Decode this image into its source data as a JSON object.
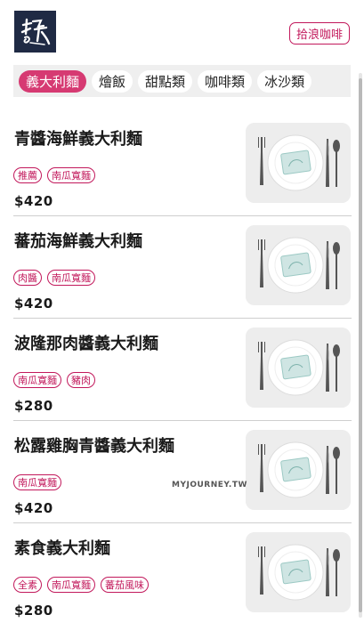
{
  "header": {
    "brand_button": "拾浪咖啡"
  },
  "tabs": [
    {
      "label": "義大利麵",
      "active": true
    },
    {
      "label": "燴飯",
      "active": false
    },
    {
      "label": "甜點類",
      "active": false
    },
    {
      "label": "咖啡類",
      "active": false
    },
    {
      "label": "冰沙類",
      "active": false
    }
  ],
  "menu": {
    "items": [
      {
        "name": "青醬海鮮義大利麵",
        "tags": [
          "推薦",
          "南瓜寬麵"
        ],
        "price": "$420"
      },
      {
        "name": "蕃茄海鮮義大利麵",
        "tags": [
          "肉醬",
          "南瓜寬麵"
        ],
        "price": "$420"
      },
      {
        "name": "波隆那肉醬義大利麵",
        "tags": [
          "南瓜寬麵",
          "豬肉"
        ],
        "price": "$280"
      },
      {
        "name": "松露雞胸青醬義大利麵",
        "tags": [
          "南瓜寬麵"
        ],
        "price": "$420"
      },
      {
        "name": "素食義大利麵",
        "tags": [
          "全素",
          "南瓜寬麵",
          "蕃茄風味"
        ],
        "price": "$280"
      }
    ]
  },
  "watermark": "MYJOURNEY.TW",
  "colors": {
    "accent": "#c2185b",
    "active_tab": "#d63a72",
    "logo_bg": "#1f2a44",
    "tab_bar_bg": "#efefef"
  },
  "icons": {
    "logo": "calligraphy-logo",
    "thumbnail": "plate-cutlery-placeholder"
  }
}
